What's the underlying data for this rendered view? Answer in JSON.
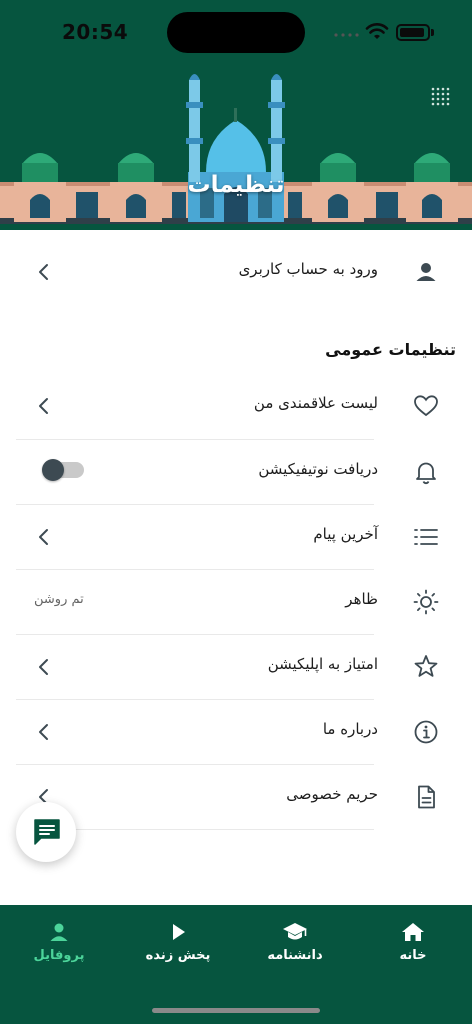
{
  "status_bar": {
    "time": "20:54"
  },
  "header": {
    "title": "تنظیمات"
  },
  "account_row": {
    "label": "ورود به حساب کاربری",
    "icon": "person-icon"
  },
  "general_section": {
    "title": "تنظیمات عمومی",
    "items": [
      {
        "label": "لیست علاقمندی من",
        "icon": "heart-icon"
      },
      {
        "label": "دریافت نوتیفیکیشن",
        "icon": "bell-icon",
        "toggle_on": false
      },
      {
        "label": "آخرین پیام",
        "icon": "list-icon"
      },
      {
        "label": "ظاهر",
        "icon": "sun-icon",
        "value": "تم روشن"
      },
      {
        "label": "امتیاز به اپلیکیشن",
        "icon": "star-icon"
      },
      {
        "label": "درباره ما",
        "icon": "info-icon"
      },
      {
        "label": "حریم خصوصی",
        "icon": "document-icon"
      }
    ]
  },
  "bottom_nav": {
    "items": [
      {
        "label": "خانه",
        "icon": "home-icon"
      },
      {
        "label": "دانشنامه",
        "icon": "graduation-cap-icon"
      },
      {
        "label": "پخش زنده",
        "icon": "play-icon"
      },
      {
        "label": "پروفایل",
        "icon": "person-icon",
        "active": true
      }
    ]
  },
  "colors": {
    "primary": "#06553f",
    "active_nav": "#4cd49a",
    "icon": "#3d4a52"
  }
}
